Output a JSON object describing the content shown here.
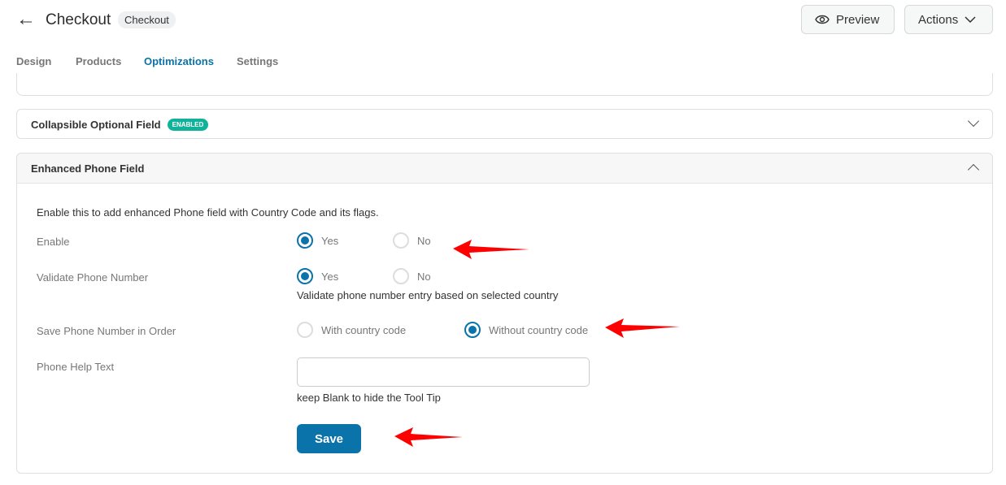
{
  "header": {
    "back_icon": "arrow-left-icon",
    "title": "Checkout",
    "chip": "Checkout",
    "preview": "Preview",
    "actions": "Actions"
  },
  "tabs": [
    {
      "label": "Design"
    },
    {
      "label": "Products"
    },
    {
      "label": "Optimizations",
      "active": true
    },
    {
      "label": "Settings"
    }
  ],
  "collapsible": {
    "title": "Collapsible Optional Field",
    "badge": "ENABLED"
  },
  "phone": {
    "title": "Enhanced Phone Field",
    "description": "Enable this to add enhanced Phone field with Country Code and its flags.",
    "enable": {
      "label": "Enable",
      "options": [
        "Yes",
        "No"
      ],
      "selected": "Yes"
    },
    "validate": {
      "label": "Validate Phone Number",
      "options": [
        "Yes",
        "No"
      ],
      "selected": "Yes",
      "help": "Validate phone number entry based on selected country"
    },
    "save_format": {
      "label": "Save Phone Number in Order",
      "options": [
        "With country code",
        "Without country code"
      ],
      "selected": "Without country code"
    },
    "help_text": {
      "label": "Phone Help Text",
      "value": "",
      "help": "keep Blank to hide the Tool Tip"
    },
    "save": "Save"
  },
  "colors": {
    "accent": "#0a73aa",
    "badge": "#10b39a",
    "arrow": "#ff0000"
  }
}
